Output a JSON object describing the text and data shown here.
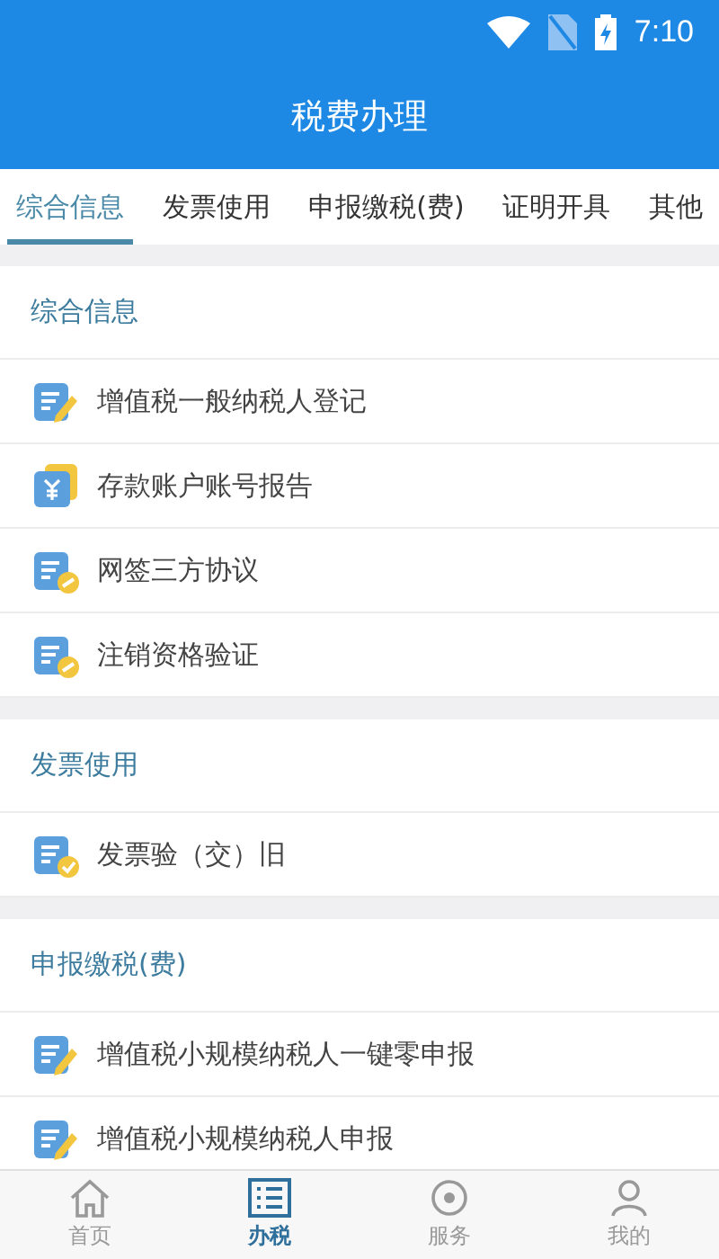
{
  "status_bar": {
    "time": "7:10"
  },
  "header": {
    "title": "税费办理"
  },
  "tabs": [
    {
      "label": "综合信息",
      "selected": true
    },
    {
      "label": "发票使用",
      "selected": false
    },
    {
      "label": "申报缴税(费)",
      "selected": false
    },
    {
      "label": "证明开具",
      "selected": false
    },
    {
      "label": "其他",
      "selected": false
    }
  ],
  "sections": [
    {
      "title": "综合信息",
      "items": [
        {
          "label": "增值税一般纳税人登记",
          "kind": "edit"
        },
        {
          "label": "存款账户账号报告",
          "kind": "money"
        },
        {
          "label": "网签三方协议",
          "kind": "link"
        },
        {
          "label": "注销资格验证",
          "kind": "link"
        }
      ]
    },
    {
      "title": "发票使用",
      "items": [
        {
          "label": "发票验（交）旧",
          "kind": "check"
        }
      ]
    },
    {
      "title": "申报缴税(费)",
      "items": [
        {
          "label": "增值税小规模纳税人一键零申报",
          "kind": "edit"
        },
        {
          "label": "增值税小规模纳税人申报",
          "kind": "edit"
        }
      ]
    }
  ],
  "bottom_nav": [
    {
      "label": "首页",
      "kind": "home",
      "selected": false
    },
    {
      "label": "办税",
      "kind": "list",
      "selected": true
    },
    {
      "label": "服务",
      "kind": "service",
      "selected": false
    },
    {
      "label": "我的",
      "kind": "user",
      "selected": false
    }
  ]
}
